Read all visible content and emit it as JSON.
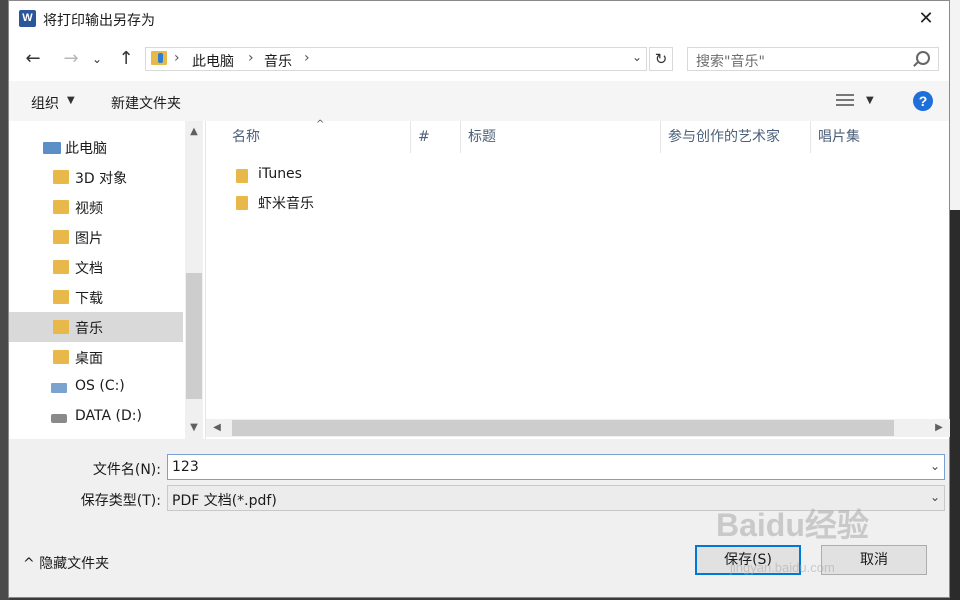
{
  "window": {
    "title": "将打印输出另存为",
    "close_glyph": "✕"
  },
  "nav": {
    "back": "←",
    "forward": "→",
    "recent": "⌄",
    "up": "↑",
    "breadcrumb": [
      "此电脑",
      "音乐"
    ],
    "separator": "›",
    "search_placeholder": "搜索\"音乐\"",
    "refresh": "↻"
  },
  "toolbar": {
    "organize": "组织",
    "new_folder": "新建文件夹",
    "help": "?"
  },
  "sidebar": {
    "items": [
      {
        "label": "此电脑",
        "icon": "pc-icon"
      },
      {
        "label": "3D 对象",
        "icon": "folder-3d-icon"
      },
      {
        "label": "视频",
        "icon": "folder-video-icon"
      },
      {
        "label": "图片",
        "icon": "folder-pictures-icon"
      },
      {
        "label": "文档",
        "icon": "folder-documents-icon"
      },
      {
        "label": "下载",
        "icon": "folder-downloads-icon"
      },
      {
        "label": "音乐",
        "icon": "folder-music-icon",
        "selected": true
      },
      {
        "label": "桌面",
        "icon": "folder-desktop-icon"
      },
      {
        "label": "OS (C:)",
        "icon": "drive-c-icon"
      },
      {
        "label": "DATA (D:)",
        "icon": "drive-d-icon"
      }
    ]
  },
  "files": {
    "columns": [
      "名称",
      "#",
      "标题",
      "参与创作的艺术家",
      "唱片集"
    ],
    "rows": [
      {
        "name": "iTunes",
        "icon": "folder-icon"
      },
      {
        "name": "虾米音乐",
        "icon": "folder-icon"
      }
    ]
  },
  "form": {
    "filename_label": "文件名(N):",
    "filename_value": "123",
    "filetype_label": "保存类型(T):",
    "filetype_value": "PDF 文档(*.pdf)"
  },
  "footer": {
    "hide_folders": "隐藏文件夹",
    "save": "保存(S)",
    "cancel": "取消"
  },
  "watermark": {
    "text": "Baidu经验",
    "sub": "jingyan.baidu.com"
  },
  "colors": {
    "accent": "#0078d7",
    "folder": "#e8b94a",
    "selected": "#d9d9d9"
  }
}
